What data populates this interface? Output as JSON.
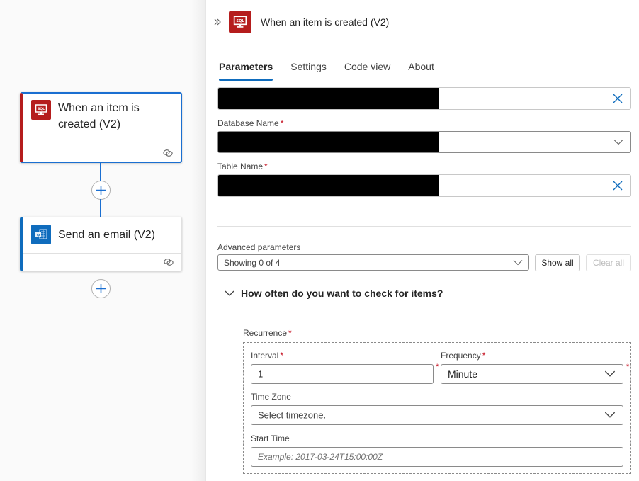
{
  "canvas": {
    "nodes": [
      {
        "title": "When an item is created (V2)",
        "title_lines": [
          "When an item is",
          "created (V2)"
        ],
        "icon": "sql-server-icon",
        "accent": "#b51d1d",
        "selected": true
      },
      {
        "title": "Send an email (V2)",
        "icon": "outlook-icon",
        "accent": "#0f6cbd",
        "selected": false
      }
    ],
    "add_step_label": "+"
  },
  "panel": {
    "title": "When an item is created (V2)",
    "icon": "sql-server-icon",
    "collapse_icon": "double-chevron-right-icon",
    "tabs": [
      {
        "label": "Parameters",
        "active": true
      },
      {
        "label": "Settings",
        "active": false
      },
      {
        "label": "Code view",
        "active": false
      },
      {
        "label": "About",
        "active": false
      }
    ],
    "fields": {
      "server": {
        "value": "[redacted]",
        "has_clear": true
      },
      "database": {
        "label": "Database Name",
        "required": "*",
        "value": "[redacted]",
        "type": "dropdown"
      },
      "table": {
        "label": "Table Name",
        "required": "*",
        "value": "[redacted]",
        "has_clear": true
      }
    },
    "advanced": {
      "label": "Advanced parameters",
      "value": "Showing 0 of 4",
      "show_all": "Show all",
      "clear_all": "Clear all"
    },
    "section": {
      "title": "How often do you want to check for items?",
      "expanded": true
    },
    "recurrence": {
      "label": "Recurrence",
      "required": "*",
      "interval": {
        "label": "Interval",
        "required": "*",
        "value": "1"
      },
      "frequency": {
        "label": "Frequency",
        "required": "*",
        "value": "Minute"
      },
      "time_zone": {
        "label": "Time Zone",
        "placeholder": "Select timezone."
      },
      "start_time": {
        "label": "Start Time",
        "placeholder": "Example: 2017-03-24T15:00:00Z"
      }
    }
  },
  "colors": {
    "sql_red": "#b51d1d",
    "outlook_blue": "#0f6cbd",
    "selection_blue": "#1a6fd1",
    "required_red": "#c50f1f"
  }
}
